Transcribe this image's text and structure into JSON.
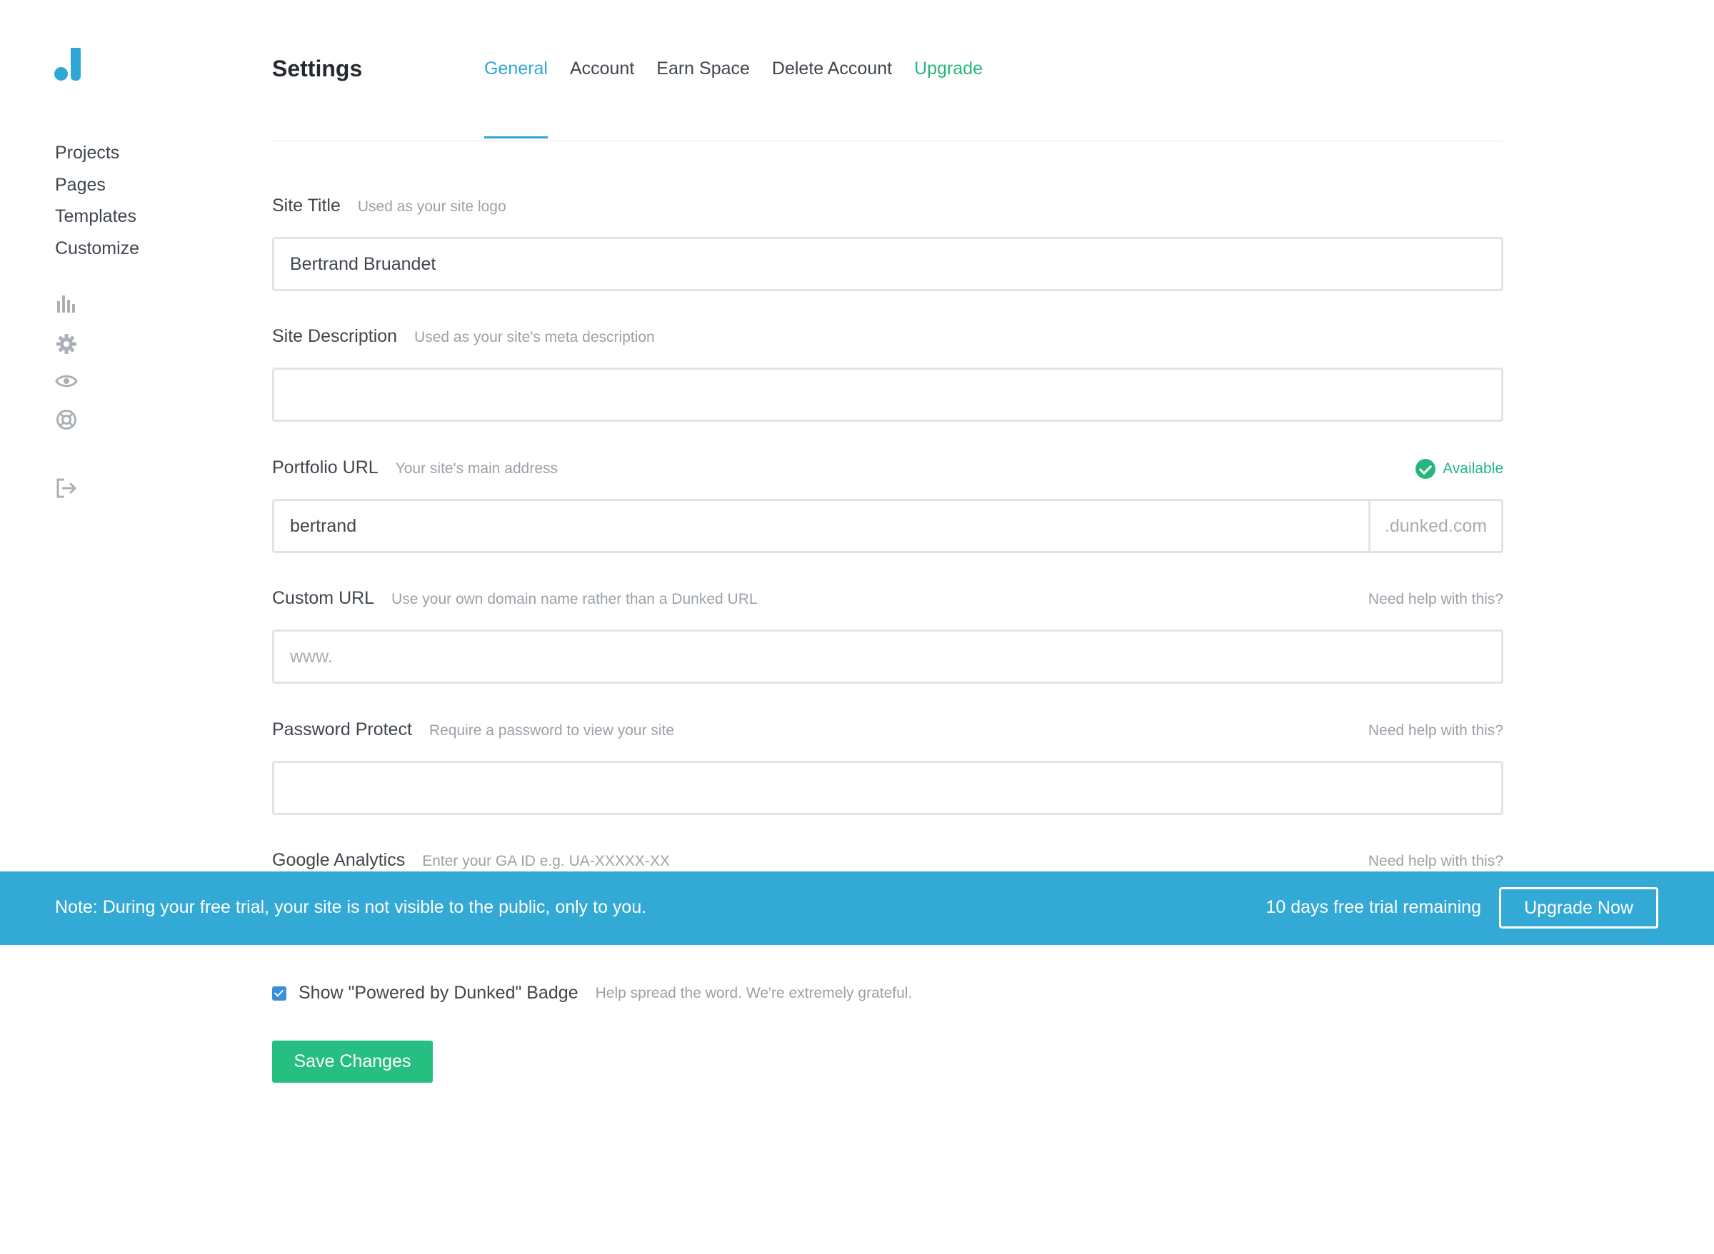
{
  "sidebar": {
    "nav": [
      {
        "label": "Projects"
      },
      {
        "label": "Pages"
      },
      {
        "label": "Templates"
      },
      {
        "label": "Customize"
      }
    ],
    "icons": [
      "stats-icon",
      "gear-icon",
      "eye-icon",
      "lifebuoy-icon",
      "logout-icon"
    ]
  },
  "header": {
    "title": "Settings",
    "tabs": [
      {
        "label": "General",
        "active": true
      },
      {
        "label": "Account"
      },
      {
        "label": "Earn Space"
      },
      {
        "label": "Delete Account"
      },
      {
        "label": "Upgrade"
      }
    ]
  },
  "form": {
    "site_title": {
      "label": "Site Title",
      "hint": "Used as your site logo",
      "value": "Bertrand Bruandet"
    },
    "site_description": {
      "label": "Site Description",
      "hint": "Used as your site's meta description",
      "value": ""
    },
    "portfolio_url": {
      "label": "Portfolio URL",
      "hint": "Your site's main address",
      "status": "Available",
      "value": "bertrand",
      "suffix": ".dunked.com"
    },
    "custom_url": {
      "label": "Custom URL",
      "hint": "Use your own domain name rather than a Dunked URL",
      "help": "Need help with this?",
      "placeholder": "www."
    },
    "password_protect": {
      "label": "Password Protect",
      "hint": "Require a password to view your site",
      "help": "Need help with this?",
      "value": ""
    },
    "google_analytics": {
      "label": "Google Analytics",
      "hint": "Enter your GA ID e.g. UA-XXXXX-XX",
      "help": "Need help with this?"
    }
  },
  "banner": {
    "note": "Note: During your free trial, your site is not visible to the public, only to you.",
    "trial": "10 days free trial remaining",
    "button": "Upgrade Now"
  },
  "badge": {
    "checked": true,
    "label": "Show \"Powered by Dunked\" Badge",
    "hint": "Help spread the word. We're extremely grateful."
  },
  "save_label": "Save Changes",
  "colors": {
    "accent": "#2ea7d6",
    "success": "#27b67e",
    "banner": "#33a9d5",
    "save_button": "#27be82"
  }
}
